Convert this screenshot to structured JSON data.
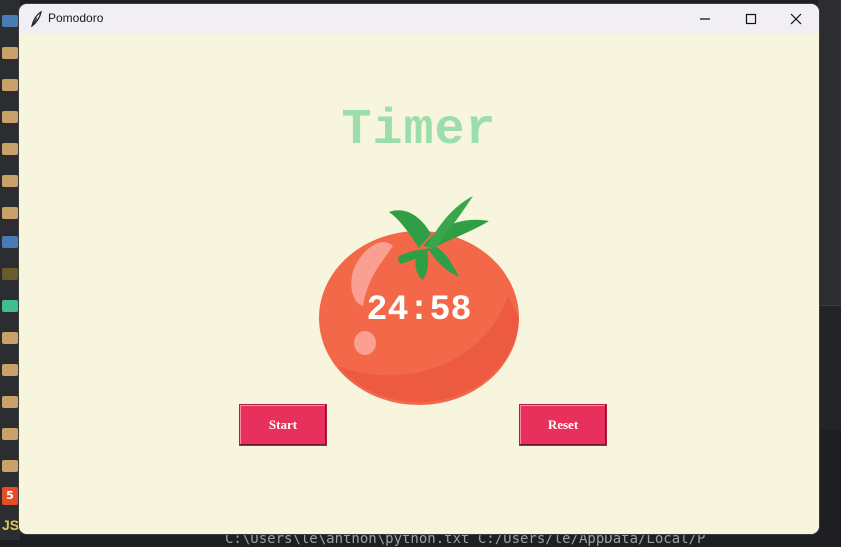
{
  "window": {
    "title": "Pomodoro"
  },
  "main": {
    "heading": "Timer",
    "time": "24:58",
    "start_label": "Start",
    "reset_label": "Reset"
  },
  "background": {
    "terminal_text": "C:\\Users\\le\\anthon\\python.txt C:/Users/le/AppData/Local/P",
    "js_text": "JS",
    "html5_text": "5"
  },
  "colors": {
    "window_bg": "#f7f5dd",
    "heading": "#9bdeac",
    "button": "#e7305b",
    "tomato": "#f26849",
    "leaf": "#2f9e44"
  },
  "icons": {
    "app": "feather-icon",
    "minimize": "minimize-icon",
    "maximize": "maximize-icon",
    "close": "close-icon"
  }
}
